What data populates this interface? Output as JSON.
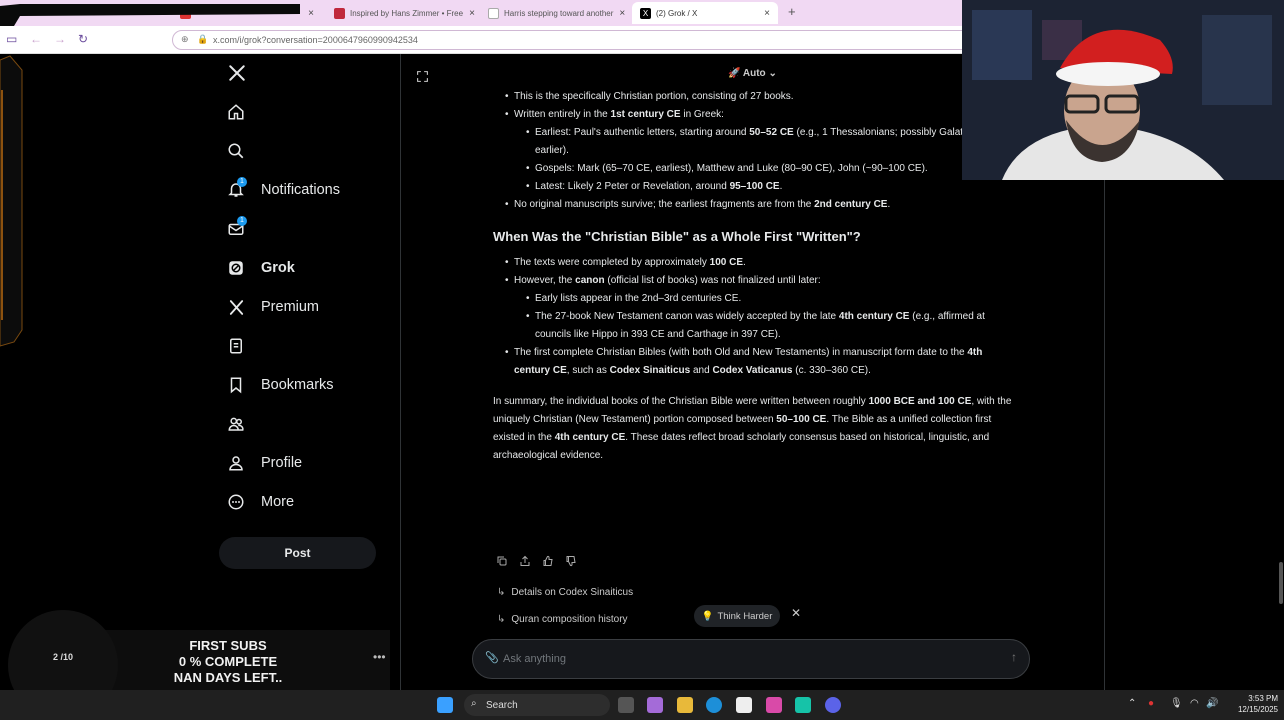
{
  "browser": {
    "tabs": [
      {
        "title": "",
        "active": false
      },
      {
        "title": "",
        "active": false
      },
      {
        "title": "Inspired by Hans Zimmer • Free",
        "active": false
      },
      {
        "title": "Harris stepping toward another",
        "active": false
      },
      {
        "title": "(2) Grok / X",
        "active": true
      }
    ],
    "url": "x.com/i/grok?conversation=2000647960990942534"
  },
  "sidebar": {
    "items": [
      {
        "name": "home",
        "label": ""
      },
      {
        "name": "explore",
        "label": ""
      },
      {
        "name": "notifications",
        "label": "Notifications",
        "badge": "1"
      },
      {
        "name": "messages",
        "label": "",
        "badge": "1"
      },
      {
        "name": "grok",
        "label": "Grok"
      },
      {
        "name": "premium",
        "label": "Premium"
      },
      {
        "name": "lists",
        "label": ""
      },
      {
        "name": "bookmarks",
        "label": "Bookmarks"
      },
      {
        "name": "communities",
        "label": ""
      },
      {
        "name": "profile",
        "label": "Profile"
      },
      {
        "name": "more",
        "label": "More"
      }
    ],
    "post_label": "Post"
  },
  "main": {
    "model_selector": "Auto",
    "bullets_top": [
      {
        "level": 1,
        "html": "This is the specifically Christian portion, consisting of 27 books."
      },
      {
        "level": 1,
        "html": "Written entirely in the <b>1st century CE</b> in Greek:"
      },
      {
        "level": 2,
        "html": "Earliest: Paul's authentic letters, starting around <b>50–52 CE</b> (e.g., 1 Thessalonians; possibly Galatians earlier)."
      },
      {
        "level": 2,
        "html": "Gospels: Mark (65–70 CE, earliest), Matthew and Luke (80–90 CE), John (~90–100 CE)."
      },
      {
        "level": 2,
        "html": "Latest: Likely 2 Peter or Revelation, around <b>95–100 CE</b>."
      },
      {
        "level": 1,
        "html": "No original manuscripts survive; the earliest fragments are from the <b>2nd century CE</b>."
      }
    ],
    "heading": "When Was the \"Christian Bible\" as a Whole First \"Written\"?",
    "bullets_bottom": [
      {
        "level": 1,
        "html": "The texts were completed by approximately <b>100 CE</b>."
      },
      {
        "level": 1,
        "html": "However, the <b>canon</b> (official list of books) was not finalized until later:"
      },
      {
        "level": 2,
        "html": "Early lists appear in the 2nd–3rd centuries CE."
      },
      {
        "level": 2,
        "html": "The 27-book New Testament canon was widely accepted by the late <b>4th century CE</b> (e.g., affirmed at councils like Hippo in 393 CE and Carthage in 397 CE)."
      },
      {
        "level": 1,
        "html": "The first complete Christian Bibles (with both Old and New Testaments) in manuscript form date to the <b>4th century CE</b>, such as <b>Codex Sinaiticus</b> and <b>Codex Vaticanus</b> (c. 330–360 CE)."
      }
    ],
    "summary": "In summary, the individual books of the Christian Bible were written between roughly <b>1000 BCE and 100 CE</b>, with the uniquely Christian (New Testament) portion composed between <b>50–100 CE</b>. The Bible as a unified collection first existed in the <b>4th century CE</b>. These dates reflect broad scholarly consensus based on historical, linguistic, and archaeological evidence.",
    "suggestions": [
      "Details on Codex Sinaiticus",
      "Quran composition history"
    ],
    "think_harder": "Think Harder",
    "ask_placeholder": "Ask anything"
  },
  "overlay": {
    "badge_text": "2 /10",
    "subs_lines": [
      "FIRST SUBS",
      "0 % COMPLETE",
      "NAN DAYS LEFT.."
    ]
  },
  "taskbar": {
    "search_label": "Search",
    "time": "3:53 PM",
    "date": "12/15/2025"
  },
  "colors": {
    "accent_blue": "#1d9bf0",
    "background": "#000000",
    "tabbar": "#f1d9f3"
  }
}
